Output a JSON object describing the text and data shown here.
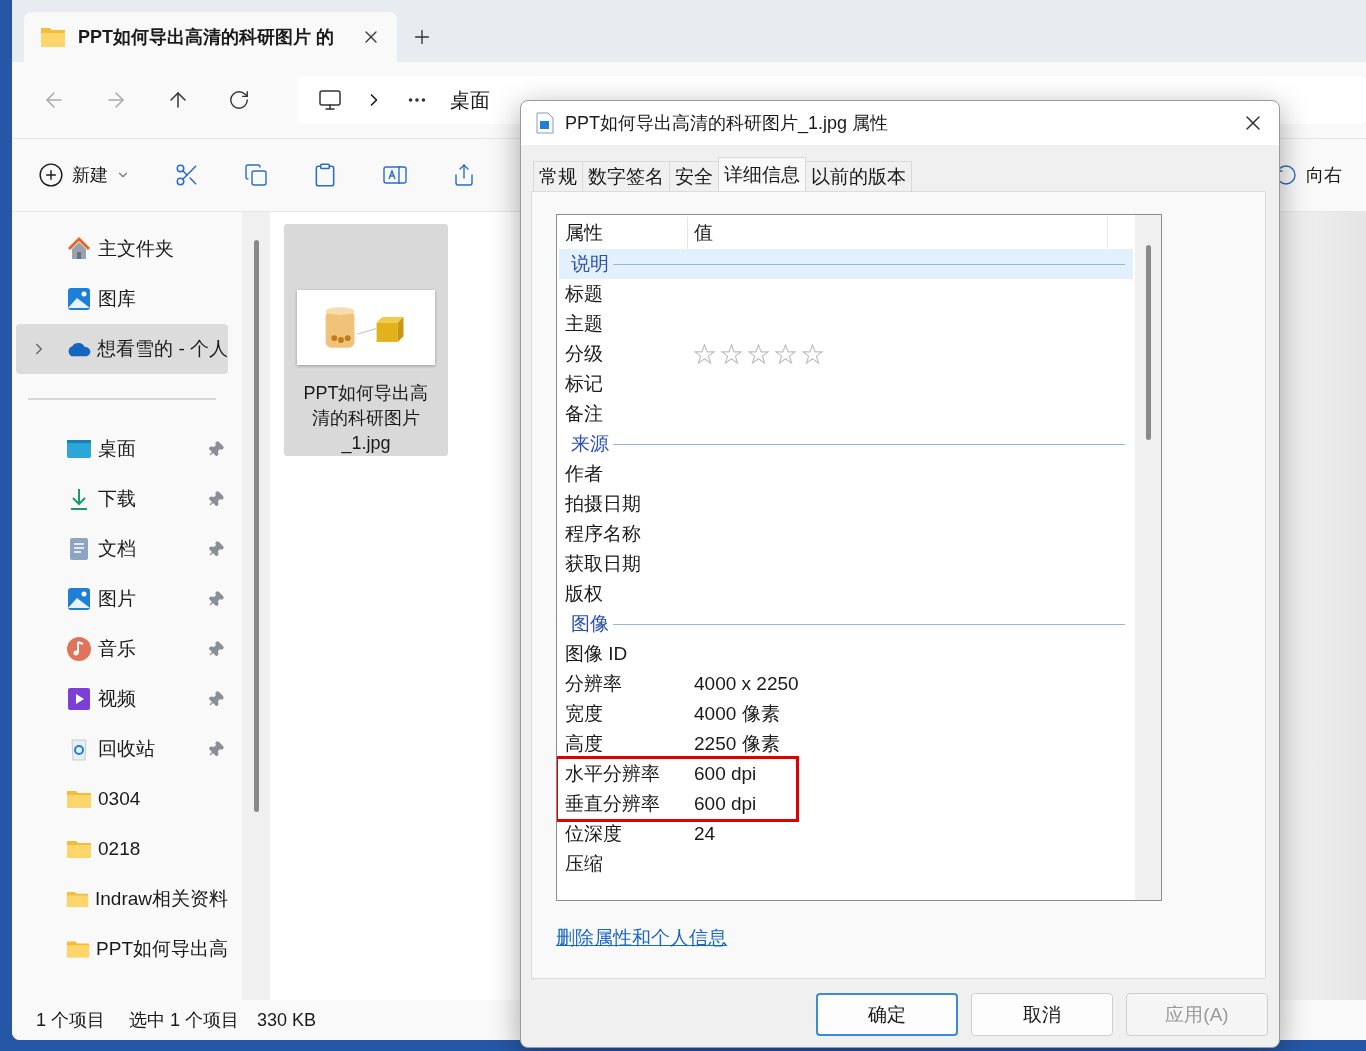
{
  "explorer": {
    "tab": {
      "title": "PPT如何导出高清的科研图片 的"
    },
    "breadcrumb": [
      "桌面"
    ],
    "toolbar": {
      "new_label": "新建",
      "rotate_label": "向右"
    },
    "sidebar": {
      "top": [
        {
          "kind": "home",
          "label": "主文件夹",
          "pinned": false,
          "selected": false
        },
        {
          "kind": "gallery",
          "label": "图库",
          "pinned": false,
          "selected": false
        },
        {
          "kind": "cloud",
          "label": "想看雪的 - 个人",
          "pinned": false,
          "selected": true
        }
      ],
      "quick": [
        {
          "kind": "desktop",
          "label": "桌面",
          "pinned": true,
          "selected": false
        },
        {
          "kind": "download",
          "label": "下载",
          "pinned": true,
          "selected": false
        },
        {
          "kind": "documents",
          "label": "文档",
          "pinned": true,
          "selected": false
        },
        {
          "kind": "pictures",
          "label": "图片",
          "pinned": true,
          "selected": false
        },
        {
          "kind": "music",
          "label": "音乐",
          "pinned": true,
          "selected": false
        },
        {
          "kind": "videos",
          "label": "视频",
          "pinned": true,
          "selected": false
        },
        {
          "kind": "recycle",
          "label": "回收站",
          "pinned": true,
          "selected": false
        },
        {
          "kind": "folder",
          "label": "0304",
          "pinned": false,
          "selected": false
        },
        {
          "kind": "folder",
          "label": "0218",
          "pinned": false,
          "selected": false
        },
        {
          "kind": "folder",
          "label": "Indraw相关资料",
          "pinned": false,
          "selected": false
        },
        {
          "kind": "folder",
          "label": "PPT如何导出高",
          "pinned": false,
          "selected": false
        }
      ]
    },
    "files": [
      {
        "name": "PPT如何导出高清的科研图片_1.jpg",
        "selected": true
      }
    ],
    "status": [
      "1 个项目",
      "选中 1 个项目",
      "330 KB"
    ]
  },
  "dialog": {
    "title": "PPT如何导出高清的科研图片_1.jpg 属性",
    "tabs": [
      {
        "label": "常规",
        "selected": false
      },
      {
        "label": "数字签名",
        "selected": false
      },
      {
        "label": "安全",
        "selected": false
      },
      {
        "label": "详细信息",
        "selected": true
      },
      {
        "label": "以前的版本",
        "selected": false
      }
    ],
    "columns": [
      "属性",
      "值"
    ],
    "rows": [
      {
        "kind": "section",
        "label": "说明",
        "selected": true
      },
      {
        "kind": "property",
        "label": "标题"
      },
      {
        "kind": "property",
        "label": "主题"
      },
      {
        "kind": "rating",
        "label": "分级",
        "stars": 0
      },
      {
        "kind": "property",
        "label": "标记"
      },
      {
        "kind": "property",
        "label": "备注"
      },
      {
        "kind": "section",
        "label": "来源",
        "selected": false
      },
      {
        "kind": "property",
        "label": "作者"
      },
      {
        "kind": "property",
        "label": "拍摄日期"
      },
      {
        "kind": "property",
        "label": "程序名称"
      },
      {
        "kind": "property",
        "label": "获取日期"
      },
      {
        "kind": "property",
        "label": "版权"
      },
      {
        "kind": "section",
        "label": "图像",
        "selected": false
      },
      {
        "kind": "property",
        "label": "图像 ID"
      },
      {
        "kind": "property",
        "label": "分辨率",
        "value": "4000 x 2250"
      },
      {
        "kind": "property",
        "label": "宽度",
        "value": "4000 像素"
      },
      {
        "kind": "property",
        "label": "高度",
        "value": "2250 像素"
      },
      {
        "kind": "highlight",
        "rows": [
          {
            "label": "水平分辨率",
            "value": "600 dpi"
          },
          {
            "label": "垂直分辨率",
            "value": "600 dpi"
          }
        ]
      },
      {
        "kind": "property",
        "label": "位深度",
        "value": "24"
      },
      {
        "kind": "property",
        "label": "压缩"
      }
    ],
    "link": "删除属性和个人信息",
    "buttons": [
      {
        "label": "确定",
        "kind": "default",
        "disabled": false
      },
      {
        "label": "取消",
        "kind": "normal",
        "disabled": false
      },
      {
        "label": "应用(A)",
        "kind": "normal",
        "disabled": true
      }
    ]
  }
}
